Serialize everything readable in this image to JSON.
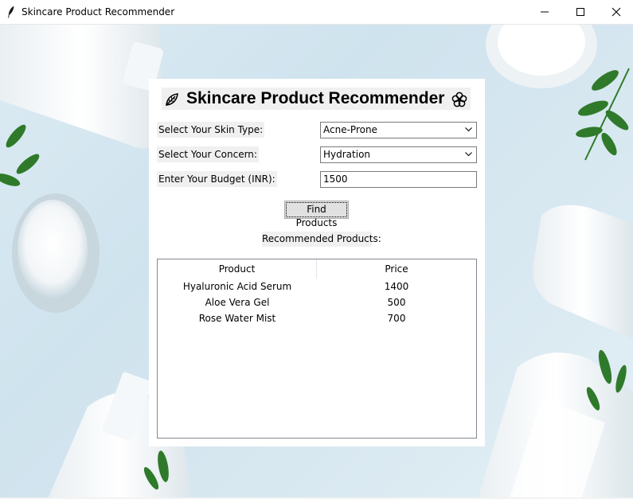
{
  "window": {
    "title": "Skincare Product Recommender",
    "icon": "feather-icon",
    "controls": [
      "minimize-icon",
      "maximize-icon",
      "close-icon"
    ]
  },
  "heading": {
    "text": "Skincare Product Recommender",
    "left_icon": "leaf-icon",
    "right_icon": "flower-icon"
  },
  "form": {
    "skin_type": {
      "label": "Select Your Skin Type:",
      "value": "Acne-Prone"
    },
    "concern": {
      "label": "Select Your Concern:",
      "value": "Hydration"
    },
    "budget": {
      "label": "Enter Your Budget (INR):",
      "value": "1500"
    },
    "find_button": "Find Products"
  },
  "results": {
    "label": "Recommended Products:",
    "columns": [
      "Product",
      "Price"
    ],
    "rows": [
      {
        "product": "Hyaluronic Acid Serum",
        "price": "1400"
      },
      {
        "product": "Aloe Vera Gel",
        "price": "500"
      },
      {
        "product": "Rose Water Mist",
        "price": "700"
      }
    ]
  }
}
